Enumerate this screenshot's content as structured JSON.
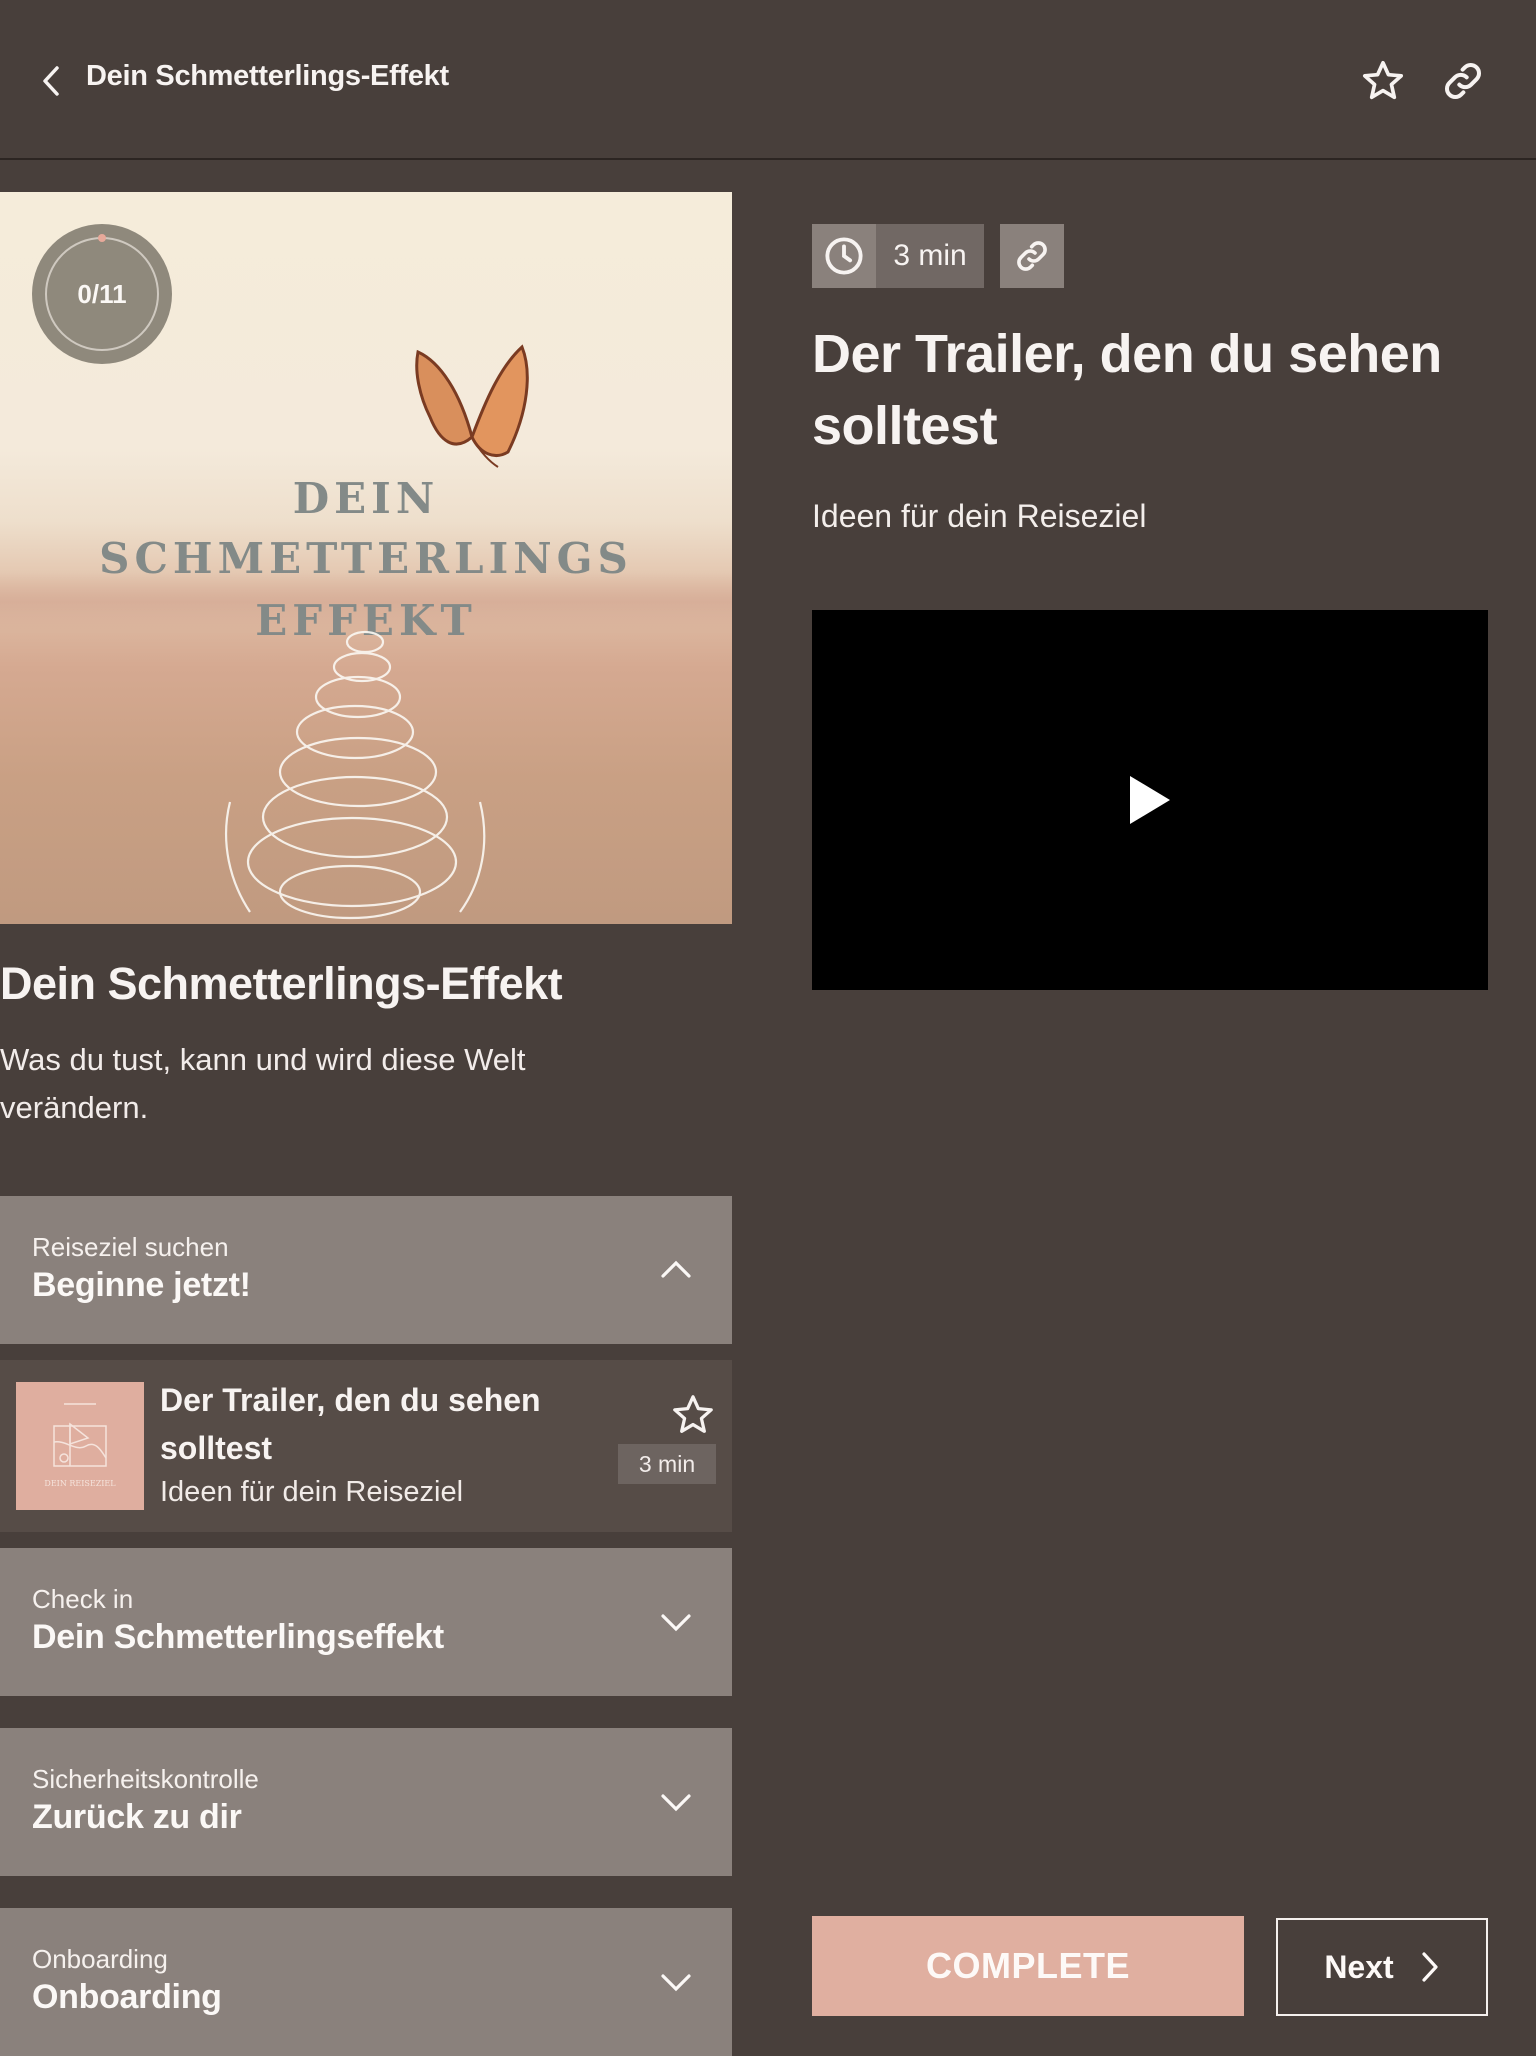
{
  "header": {
    "title": "Dein Schmetterlings-Effekt",
    "back_icon": "chevron-left-icon",
    "favorite_icon": "star-outline-icon",
    "share_icon": "link-icon"
  },
  "course": {
    "cover": {
      "line1": "DEIN",
      "line2": "SCHMETTERLINGS",
      "line3": "EFFEKT"
    },
    "progress": {
      "completed": 0,
      "total": 11,
      "label": "0/11",
      "fraction": 0.0
    },
    "title": "Dein Schmetterlings-Effekt",
    "description": "Was du tust, kann und wird diese Welt verändern."
  },
  "sections": [
    {
      "subtitle": "Reiseziel suchen",
      "title": "Beginne jetzt!",
      "expanded": true,
      "chevron": "chevron-up-icon"
    },
    {
      "subtitle": "Check in",
      "title": "Dein Schmetterlingseffekt",
      "expanded": false,
      "chevron": "chevron-down-icon"
    },
    {
      "subtitle": "Sicherheitskontrolle",
      "title": "Zurück zu dir",
      "expanded": false,
      "chevron": "chevron-down-icon"
    },
    {
      "subtitle": "Onboarding",
      "title": "Onboarding",
      "expanded": false,
      "chevron": "chevron-down-icon"
    }
  ],
  "lessons": [
    {
      "title": "Der Trailer, den du sehen solltest",
      "subtitle": "Ideen für dein Reiseziel",
      "duration": "3 min",
      "thumbnail_caption": "DEIN REISEZIEL"
    }
  ],
  "detail": {
    "duration": "3 min",
    "title": "Der Trailer, den du sehen solltest",
    "subtitle": "Ideen für dein Reiseziel",
    "video_icon": "play-icon"
  },
  "actions": {
    "complete_label": "COMPLETE",
    "next_label": "Next"
  },
  "colors": {
    "background": "#483f3b",
    "section": "#8a817c",
    "lesson_row": "#564c47",
    "accent": "#e0afa0",
    "progress_dot": "#e7a99a"
  }
}
